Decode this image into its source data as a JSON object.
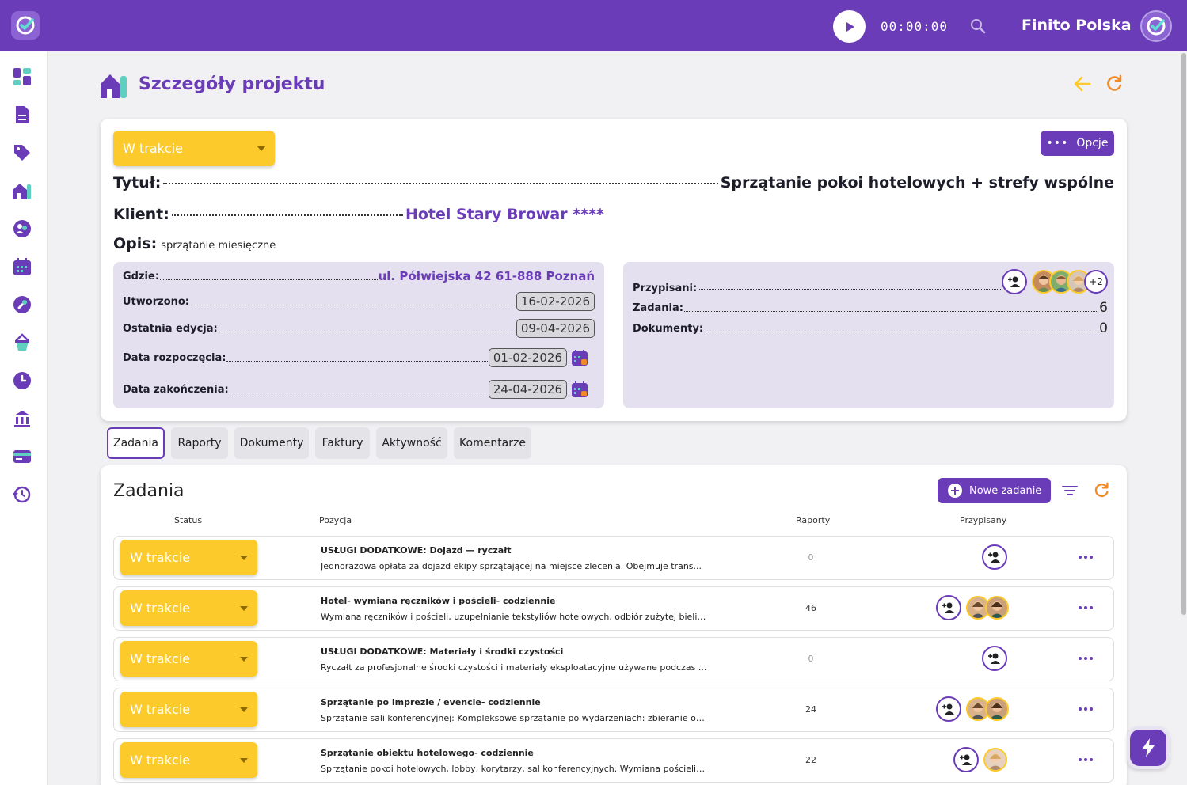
{
  "topbar": {
    "timer": "00:00:00",
    "company": "Finito Polska"
  },
  "page": {
    "title": "Szczegóły projektu"
  },
  "project": {
    "status": "W trakcie",
    "options_label": "Opcje",
    "title_label": "Tytuł:",
    "title_value": "Sprzątanie pokoi hotelowych + strefy wspólne",
    "client_label": "Klient:",
    "client_value": "Hotel Stary Browar ****",
    "desc_label": "Opis:",
    "desc_value": "sprzątanie miesięczne",
    "where_label": "Gdzie:",
    "where_value": "ul. Półwiejska 42 61-888 Poznań",
    "created_label": "Utworzono:",
    "created_value": "16-02-2026",
    "edited_label": "Ostatnia edycja:",
    "edited_value": "09-04-2026",
    "start_label": "Data rozpoczęcia:",
    "start_value": "01-02-2026",
    "end_label": "Data zakończenia:",
    "end_value": "24-04-2026",
    "assigned_label": "Przypisani:",
    "assigned_more": "+2",
    "tasks_label": "Zadania:",
    "tasks_value": "6",
    "docs_label": "Dokumenty:",
    "docs_value": "0"
  },
  "tabs": [
    "Zadania",
    "Raporty",
    "Dokumenty",
    "Faktury",
    "Aktywność",
    "Komentarze"
  ],
  "tasks": {
    "title": "Zadania",
    "new_label": "Nowe zadanie",
    "columns": [
      "Status",
      "Pozycja",
      "Raporty",
      "Przypisany"
    ],
    "rows": [
      {
        "status": "W trakcie",
        "title": "USŁUGI DODATKOWE: Dojazd — ryczałt",
        "desc": "Jednorazowa opłata za dojazd ekipy sprzątającej na miejsce zlecenia. Obejmuje trans...",
        "reports": "0"
      },
      {
        "status": "W trakcie",
        "title": "Hotel- wymiana ręczników i pościeli- codziennie",
        "desc": "Wymiana ręczników i pościeli, uzupełnianie tekstyliów hotelowych, odbiór zużytej bieliz...",
        "reports": "46"
      },
      {
        "status": "W trakcie",
        "title": "USŁUGI DODATKOWE: Materiały i środki czystości",
        "desc": "Ryczałt za profesjonalne środki czystości i materiały eksploatacyjne używane podczas ...",
        "reports": "0"
      },
      {
        "status": "W trakcie",
        "title": "Sprzątanie po imprezie / evencie- codziennie",
        "desc": "Sprzątanie sali konferencyjnej: Kompleksowe sprzątanie po wydarzeniach: zbieranie od...",
        "reports": "24"
      },
      {
        "status": "W trakcie",
        "title": "Sprzątanie obiektu hotelowego- codziennie",
        "desc": "Sprzątanie pokoi hotelowych, lobby, korytarzy, sal konferencyjnych. Wymiana pościeli i ...",
        "reports": "22"
      }
    ]
  },
  "colors": {
    "brand": "#6a3cb8",
    "status": "#fcca2b",
    "accent": "#f08a24"
  }
}
